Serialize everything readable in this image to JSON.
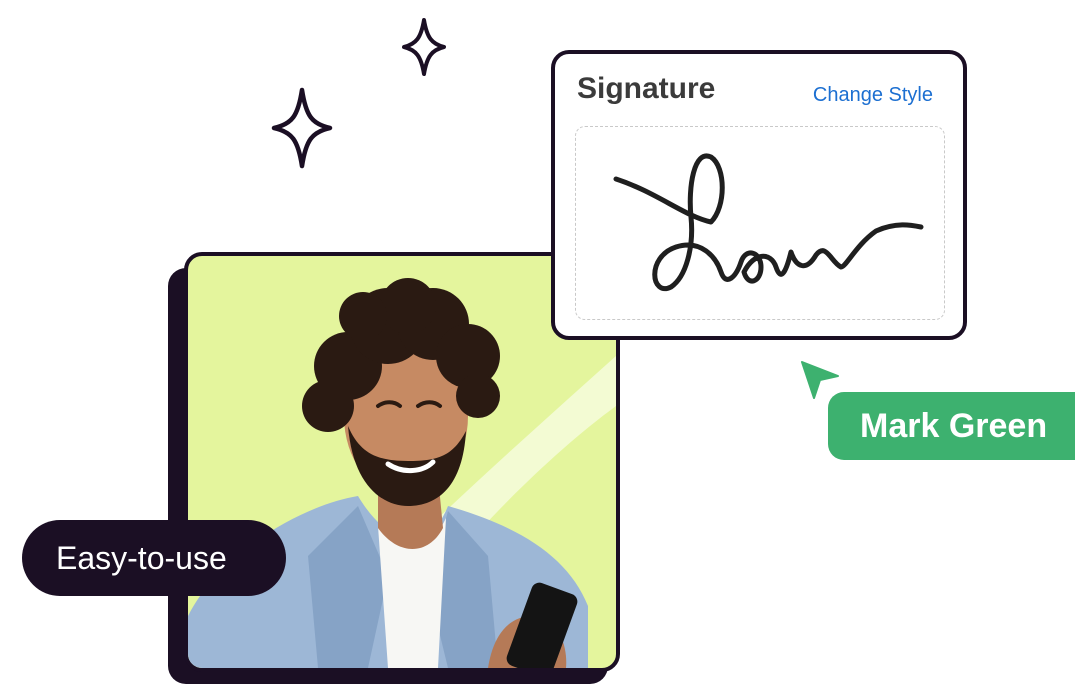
{
  "signature_card": {
    "title": "Signature",
    "change_style_label": "Change Style"
  },
  "signer_tag": {
    "name": "Mark Green"
  },
  "feature_pill": {
    "label": "Easy-to-use"
  },
  "colors": {
    "dark": "#1b0f24",
    "photo_background": "#e4f59d",
    "accent_green": "#3db16f",
    "link_blue": "#1c6fd1"
  },
  "icons": [
    "sparkle-icon",
    "cursor-arrow-icon"
  ]
}
